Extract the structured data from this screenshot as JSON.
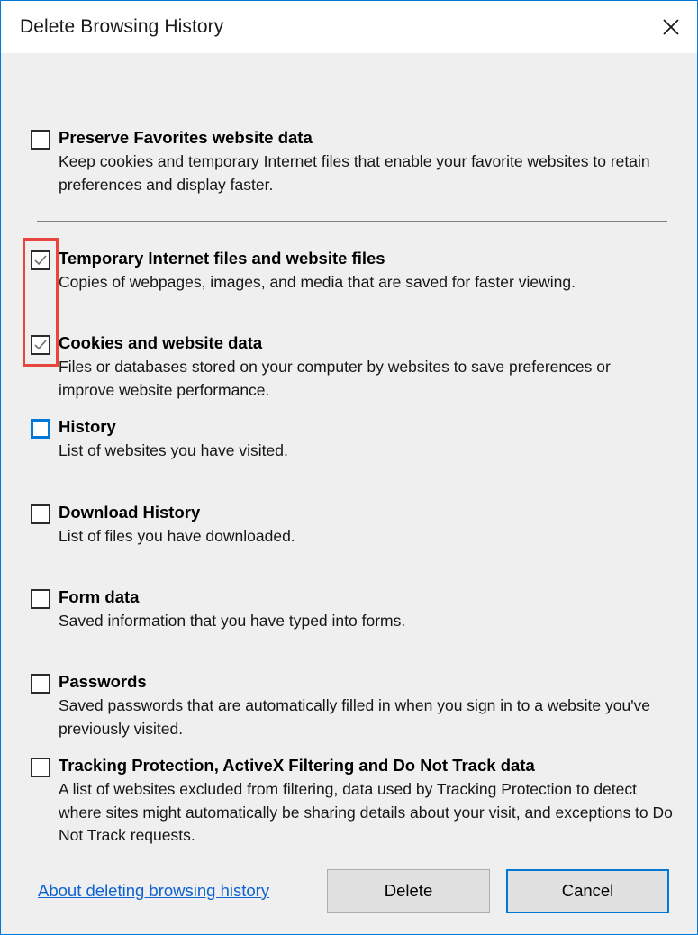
{
  "window": {
    "title": "Delete Browsing History",
    "close_label": "×",
    "close_icon": "close-icon",
    "border_color": "#0078d7",
    "titlebar_bg": "#ffffff",
    "body_bg": "#efefef"
  },
  "highlight": {
    "color": "#e8453c",
    "note": "red annotation rectangle around the two checked checkboxes"
  },
  "options": [
    {
      "id": "preserve-favorites",
      "label": "Preserve Favorites website data",
      "description": "Keep cookies and temporary Internet files that enable your favorite websites to retain preferences and display faster.",
      "checked": false,
      "focused": false
    },
    {
      "id": "temporary-internet-files",
      "label": "Temporary Internet files and website files",
      "description": "Copies of webpages, images, and media that are saved for faster viewing.",
      "checked": true,
      "focused": false
    },
    {
      "id": "cookies-and-website-data",
      "label": "Cookies and website data",
      "description": "Files or databases stored on your computer by websites to save preferences or improve website performance.",
      "checked": true,
      "focused": false
    },
    {
      "id": "history",
      "label": "History",
      "description": "List of websites you have visited.",
      "checked": false,
      "focused": true
    },
    {
      "id": "download-history",
      "label": "Download History",
      "description": "List of files you have downloaded.",
      "checked": false,
      "focused": false
    },
    {
      "id": "form-data",
      "label": "Form data",
      "description": "Saved information that you have typed into forms.",
      "checked": false,
      "focused": false
    },
    {
      "id": "passwords",
      "label": "Passwords",
      "description": "Saved passwords that are automatically filled in when you sign in to a website you've previously visited.",
      "checked": false,
      "focused": false
    },
    {
      "id": "tracking-protection",
      "label": "Tracking Protection, ActiveX Filtering and Do Not Track data",
      "description": "A list of websites excluded from filtering, data used by Tracking Protection to detect where sites might automatically be sharing details about your visit, and exceptions to Do Not Track requests.",
      "checked": false,
      "focused": false
    }
  ],
  "footer": {
    "help_link": "About deleting browsing history",
    "delete_label": "Delete",
    "cancel_label": "Cancel",
    "link_color": "#0f62d0",
    "focus_color": "#0078d7"
  }
}
